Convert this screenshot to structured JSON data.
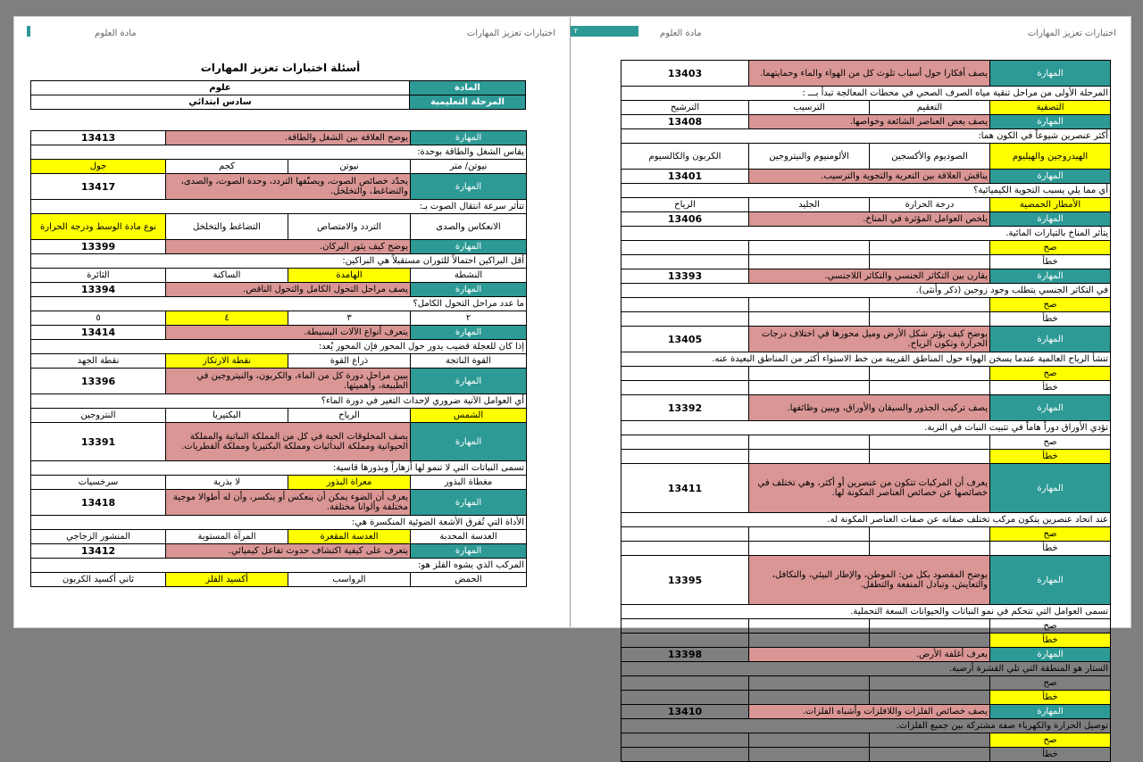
{
  "header": {
    "subject_label": "مادة العلوم",
    "title_label": "اختبارات تعزيز المهارات",
    "page_num": "٢"
  },
  "left": {
    "doc_title": "أسئلة اختبارات تعزيز المهارات",
    "meta": [
      {
        "label": "المادة",
        "value": "علوم"
      },
      {
        "label": "المرحلة التعليمية",
        "value": "سادس ابتدائي"
      }
    ],
    "skill_label": "المهارة",
    "blocks": [
      {
        "code": "13413",
        "skill": "يوضح العلاقة بين الشغل والطاقة.",
        "question": "يقاس الشغل والطاقة بوحدة:",
        "options": [
          "نيوتن/ متر",
          "نيوتن",
          "كجم",
          "جول"
        ],
        "correct": 3
      },
      {
        "code": "13417",
        "skill": "يحدّد خصائص الصوت، ويصنّفها التردد، وحدة الصوت، والصدى، والتضاغط، والتخلخل.",
        "question": "تتأثر سرعة انتقال الصوت بـ:",
        "options": [
          "الانعكاس والصدى",
          "التردد والامتصاص",
          "التضاغط والتخلخل",
          "نوع مادة الوسط ودرجة الحرارة"
        ],
        "correct": 3
      },
      {
        "code": "13399",
        "skill": "يوضح كيف يثور البركان.",
        "question": "أقل البراكين احتمالاً للثوران مستقبلاً هي البراكين:",
        "options": [
          "النشطة",
          "الهامدة",
          "الساكنة",
          "الثائرة"
        ],
        "correct": 1
      },
      {
        "code": "13394",
        "skill": "يصف مراحل التحول الكامل والتحول الناقص.",
        "question": "ما عدد مراحل التحول الكامل؟",
        "options": [
          "٢",
          "٣",
          "٤",
          "٥"
        ],
        "correct": 2
      },
      {
        "code": "13414",
        "skill": "يتعرف أنواع الآلات البسيطة.",
        "question": "إذا كان للعجلة قضيب يدور حول المحور فإن المحور يُعد:",
        "options": [
          "القوة الناتجة",
          "ذراع القوة",
          "نقطة الارتكاز",
          "نقطة الجهد"
        ],
        "correct": 2
      },
      {
        "code": "13396",
        "skill": "يبين مراحل دورة كل من الماء، والكربون، والنيتروجين في الطبيعة، وأهميتها.",
        "question": "أي العوامل الآتية ضروري لإحداث التغير في دورة الماء؟",
        "options": [
          "الشمس",
          "الرياح",
          "البكتيريا",
          "النتروجين"
        ],
        "correct": 0
      },
      {
        "code": "13391",
        "skill": "يصف المخلوقات الحية في كل من المملكة النباتية والمملكة الحيوانية ومملكة البدائيات ومملكة البكتيريا ومملكة الفطريات.",
        "question": "تسمى النباتات التي لا تنمو لها أزهاراً وبذورها قاسية:",
        "options": [
          "مغطاة البذور",
          "معراة البذور",
          "لا بذرية",
          "سرخسيات"
        ],
        "correct": 1
      },
      {
        "code": "13418",
        "skill": "يعرف أن الضوء يمكن أن ينعكس أو ينكسر، وأن له أطوالا موجية مختلفة وألوانا مختلفة.",
        "question": "الأداة التي تُفرق الأشعة الضوئية المنكسرة هي:",
        "options": [
          "العدسة المحدبة",
          "العدسة المقعرة",
          "المرآة المستوية",
          "المنشور الزجاجي"
        ],
        "correct": 1
      },
      {
        "code": "13412",
        "skill": "يتعرف على كيفية اكتشاف حدوث تفاعل كيميائي.",
        "question": "المركب الذي يشوه الفلز هو:",
        "options": [
          "الحمض",
          "الرواسب",
          "أكسيد الفلز",
          "ثاني أكسيد الكربون"
        ],
        "correct": 2
      }
    ]
  },
  "right": {
    "skill_label": "المهارة",
    "blocks": [
      {
        "code": "13403",
        "skill": "يصف أفكارا حول أسباب تلوث كل من الهواء والماء وحمايتهما.",
        "question": "المرحلة الأولى من مراحل تنقية مياه الصرف الصحي في محطات المعالجة تبدأ بـــ :",
        "options": [
          "التصفية",
          "التعقيم",
          "الترسيب",
          "الترشيح"
        ],
        "correct": 0
      },
      {
        "code": "13408",
        "skill": "يصف بعض العناصر الشائعة وخواصها.",
        "question": "أكثر عنصرين شيوعاً في الكون هما:",
        "options": [
          "الهيدروجين والهيليوم",
          "الصوديوم والأكسجين",
          "الألومنيوم والنيتروجين",
          "الكربون والكالسيوم"
        ],
        "correct": 0
      },
      {
        "code": "13401",
        "skill": "يناقش العلاقة بين التعرية والتجوية والترسيب.",
        "question": "أي مما يلي يسبب التجوية الكيميائية؟",
        "options": [
          "الأمطار الحمضية",
          "درجة الحرارة",
          "الجليد",
          "الرياح"
        ],
        "correct": 0
      },
      {
        "code": "13406",
        "skill": "يلخص العوامل المؤثرة في المناخ.",
        "question": "يتأثر المناخ بالتيارات المائية.",
        "options": [
          "صح",
          "خطأ"
        ],
        "correct": 0
      },
      {
        "code": "13393",
        "skill": "يقارن بين التكاثر الجنسي والتكاثر اللاجنسي.",
        "question": "في التكاثر الجنسي يتطلب وجود زوجين (ذكر وأنثى).",
        "options": [
          "صح",
          "خطأ"
        ],
        "correct": 0
      },
      {
        "code": "13405",
        "skill": "يوضح كيف يؤثر شكل الأرض وميل محورها في اختلاف درجات الحرارة وتكون الرياح.",
        "question": "تنشأ الرياح العالمية عندما يسخن الهواء حول المناطق القريبة من خط الاستواء أكثر من المناطق البعيدة عنه.",
        "options": [
          "صح",
          "خطأ"
        ],
        "correct": 0
      },
      {
        "code": "13392",
        "skill": "يصف تركيب الجذور والسيقان والأوراق، ويبين وظائفها.",
        "question": "تؤدي الأوراق دوراً هاماً في تثبيت النبات في التربة.",
        "options": [
          "صح",
          "خطأ"
        ],
        "correct": 1
      },
      {
        "code": "13411",
        "skill": "يعرف أن المركبات تتكون من عنصرين أو أكثر، وهي تختلف في خصائصها عن خصائص العناصر المكونة لها.",
        "question": "عند اتحاد عنصرين يتكون مركب تختلف صفاته عن صفات العناصر المكونة له.",
        "options": [
          "صح",
          "خطأ"
        ],
        "correct": 0
      },
      {
        "code": "13395",
        "skill": "يوضح المقصود بكل من: الموطن، والإطار البيئي، والتكافل، والتعايش، وتبادل المنفعة والتطفل.",
        "question": "تسمى العوامل التي تتحكم في نمو النباتات والحيوانات السعة التحملية.",
        "options": [
          "صح",
          "خطأ"
        ],
        "correct": 1
      },
      {
        "code": "13398",
        "skill": "يعرف أغلفة الأرض.",
        "question": "الستار هو المنطقة التي تلي القشرة أرضية.",
        "options": [
          "صح",
          "خطأ"
        ],
        "correct": 1
      },
      {
        "code": "13410",
        "skill": "يصف خصائص الفلزات واللافلزات وأشباه الفلزات.",
        "question": "توصيل الحرارة والكهرباء صفة مشتركة بين جميع الفلزات.",
        "options": [
          "صح",
          "خطأ"
        ],
        "correct": 0
      }
    ]
  },
  "colors": {
    "teal": "#2e9a96",
    "pink": "#d99694",
    "yellow": "#ffff00",
    "background": "#7f7f7f"
  }
}
